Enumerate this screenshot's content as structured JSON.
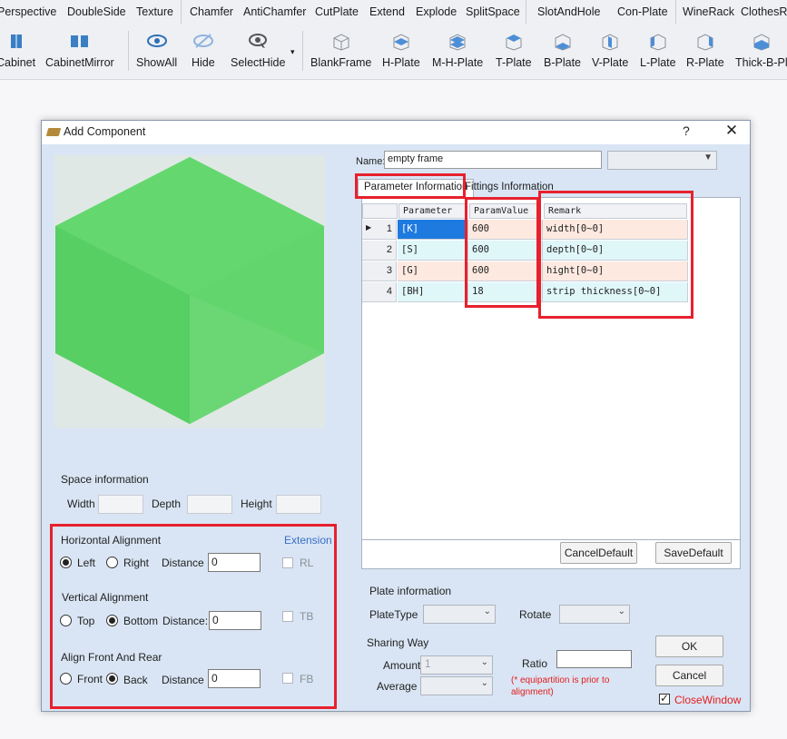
{
  "ribbon": {
    "row1": [
      "Perspective",
      "DoubleSide",
      "Texture",
      "Chamfer",
      "AntiChamfer",
      "CutPlate",
      "Extend",
      "Explode",
      "SplitSpace",
      "SlotAndHole",
      "Con-Plate",
      "WineRack",
      "ClothesRo"
    ],
    "row2": [
      "Cabinet",
      "CabinetMirror",
      "ShowAll",
      "Hide",
      "SelectHide",
      "BlankFrame",
      "H-Plate",
      "M-H-Plate",
      "T-Plate",
      "B-Plate",
      "V-Plate",
      "L-Plate",
      "R-Plate",
      "Thick-B-Pl"
    ]
  },
  "dialog": {
    "title": "Add Component",
    "help": "?",
    "close": "✕",
    "name_label": "Name:",
    "name_value": "empty frame",
    "tabs": [
      "Parameter Information",
      "Fittings Information"
    ],
    "grid": {
      "headers": [
        "Parameter",
        "ParamValue",
        "Remark"
      ],
      "rows": [
        {
          "n": "1",
          "param": "[K]",
          "value": "600",
          "remark": "width[0~0]"
        },
        {
          "n": "2",
          "param": "[S]",
          "value": "600",
          "remark": "depth[0~0]"
        },
        {
          "n": "3",
          "param": "[G]",
          "value": "600",
          "remark": "hight[0~0]"
        },
        {
          "n": "4",
          "param": "[BH]",
          "value": "18",
          "remark": "strip thickness[0~0]"
        }
      ]
    },
    "cancel_default": "CancelDefault",
    "save_default": "SaveDefault",
    "space": {
      "title": "Space information",
      "width": "Width",
      "depth": "Depth",
      "height": "Height"
    },
    "align": {
      "horizontal": "Horizontal Alignment",
      "extension": "Extension",
      "left": "Left",
      "right": "Right",
      "distance": "Distance",
      "h_value": "0",
      "rl": "RL",
      "vertical": "Vertical Alignment",
      "top": "Top",
      "bottom": "Bottom",
      "distance_colon": "Distance:",
      "v_value": "0",
      "tb": "TB",
      "frontrear": "Align Front And Rear",
      "front": "Front",
      "back": "Back",
      "f_value": "0",
      "fb": "FB"
    },
    "plate": {
      "title": "Plate information",
      "plate_type": "PlateType",
      "rotate": "Rotate"
    },
    "sharing": {
      "title": "Sharing Way",
      "amount": "Amount",
      "amount_value": "1",
      "average": "Average",
      "ratio": "Ratio",
      "note_line1": "(* equipartition is prior to",
      "note_line2": "alignment)"
    },
    "ok": "OK",
    "cancel": "Cancel",
    "close_window": "CloseWindow",
    "colors": {
      "accent_red": "#e8202e",
      "cube_green": "#5cd26a",
      "dialog_bg": "#d9e5f4"
    }
  }
}
